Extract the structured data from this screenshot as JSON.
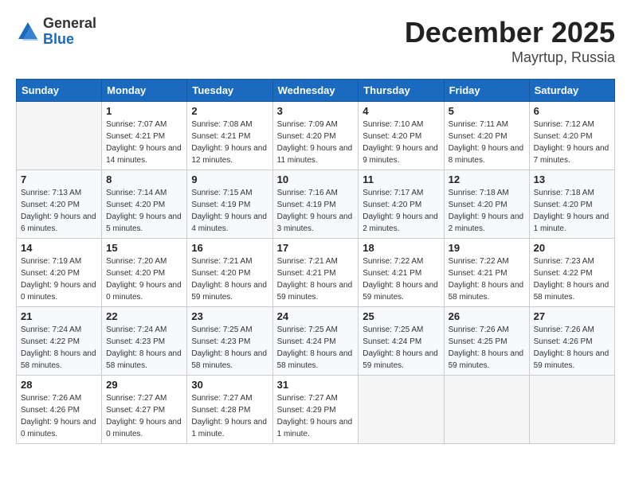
{
  "header": {
    "logo_general": "General",
    "logo_blue": "Blue",
    "month": "December 2025",
    "location": "Mayrtup, Russia"
  },
  "weekdays": [
    "Sunday",
    "Monday",
    "Tuesday",
    "Wednesday",
    "Thursday",
    "Friday",
    "Saturday"
  ],
  "weeks": [
    [
      null,
      {
        "day": "1",
        "sunrise": "7:07 AM",
        "sunset": "4:21 PM",
        "daylight": "9 hours and 14 minutes."
      },
      {
        "day": "2",
        "sunrise": "7:08 AM",
        "sunset": "4:21 PM",
        "daylight": "9 hours and 12 minutes."
      },
      {
        "day": "3",
        "sunrise": "7:09 AM",
        "sunset": "4:20 PM",
        "daylight": "9 hours and 11 minutes."
      },
      {
        "day": "4",
        "sunrise": "7:10 AM",
        "sunset": "4:20 PM",
        "daylight": "9 hours and 9 minutes."
      },
      {
        "day": "5",
        "sunrise": "7:11 AM",
        "sunset": "4:20 PM",
        "daylight": "9 hours and 8 minutes."
      },
      {
        "day": "6",
        "sunrise": "7:12 AM",
        "sunset": "4:20 PM",
        "daylight": "9 hours and 7 minutes."
      }
    ],
    [
      {
        "day": "7",
        "sunrise": "7:13 AM",
        "sunset": "4:20 PM",
        "daylight": "9 hours and 6 minutes."
      },
      {
        "day": "8",
        "sunrise": "7:14 AM",
        "sunset": "4:20 PM",
        "daylight": "9 hours and 5 minutes."
      },
      {
        "day": "9",
        "sunrise": "7:15 AM",
        "sunset": "4:19 PM",
        "daylight": "9 hours and 4 minutes."
      },
      {
        "day": "10",
        "sunrise": "7:16 AM",
        "sunset": "4:19 PM",
        "daylight": "9 hours and 3 minutes."
      },
      {
        "day": "11",
        "sunrise": "7:17 AM",
        "sunset": "4:20 PM",
        "daylight": "9 hours and 2 minutes."
      },
      {
        "day": "12",
        "sunrise": "7:18 AM",
        "sunset": "4:20 PM",
        "daylight": "9 hours and 2 minutes."
      },
      {
        "day": "13",
        "sunrise": "7:18 AM",
        "sunset": "4:20 PM",
        "daylight": "9 hours and 1 minute."
      }
    ],
    [
      {
        "day": "14",
        "sunrise": "7:19 AM",
        "sunset": "4:20 PM",
        "daylight": "9 hours and 0 minutes."
      },
      {
        "day": "15",
        "sunrise": "7:20 AM",
        "sunset": "4:20 PM",
        "daylight": "9 hours and 0 minutes."
      },
      {
        "day": "16",
        "sunrise": "7:21 AM",
        "sunset": "4:20 PM",
        "daylight": "8 hours and 59 minutes."
      },
      {
        "day": "17",
        "sunrise": "7:21 AM",
        "sunset": "4:21 PM",
        "daylight": "8 hours and 59 minutes."
      },
      {
        "day": "18",
        "sunrise": "7:22 AM",
        "sunset": "4:21 PM",
        "daylight": "8 hours and 59 minutes."
      },
      {
        "day": "19",
        "sunrise": "7:22 AM",
        "sunset": "4:21 PM",
        "daylight": "8 hours and 58 minutes."
      },
      {
        "day": "20",
        "sunrise": "7:23 AM",
        "sunset": "4:22 PM",
        "daylight": "8 hours and 58 minutes."
      }
    ],
    [
      {
        "day": "21",
        "sunrise": "7:24 AM",
        "sunset": "4:22 PM",
        "daylight": "8 hours and 58 minutes."
      },
      {
        "day": "22",
        "sunrise": "7:24 AM",
        "sunset": "4:23 PM",
        "daylight": "8 hours and 58 minutes."
      },
      {
        "day": "23",
        "sunrise": "7:25 AM",
        "sunset": "4:23 PM",
        "daylight": "8 hours and 58 minutes."
      },
      {
        "day": "24",
        "sunrise": "7:25 AM",
        "sunset": "4:24 PM",
        "daylight": "8 hours and 58 minutes."
      },
      {
        "day": "25",
        "sunrise": "7:25 AM",
        "sunset": "4:24 PM",
        "daylight": "8 hours and 59 minutes."
      },
      {
        "day": "26",
        "sunrise": "7:26 AM",
        "sunset": "4:25 PM",
        "daylight": "8 hours and 59 minutes."
      },
      {
        "day": "27",
        "sunrise": "7:26 AM",
        "sunset": "4:26 PM",
        "daylight": "8 hours and 59 minutes."
      }
    ],
    [
      {
        "day": "28",
        "sunrise": "7:26 AM",
        "sunset": "4:26 PM",
        "daylight": "9 hours and 0 minutes."
      },
      {
        "day": "29",
        "sunrise": "7:27 AM",
        "sunset": "4:27 PM",
        "daylight": "9 hours and 0 minutes."
      },
      {
        "day": "30",
        "sunrise": "7:27 AM",
        "sunset": "4:28 PM",
        "daylight": "9 hours and 1 minute."
      },
      {
        "day": "31",
        "sunrise": "7:27 AM",
        "sunset": "4:29 PM",
        "daylight": "9 hours and 1 minute."
      },
      null,
      null,
      null
    ]
  ],
  "labels": {
    "sunrise_prefix": "Sunrise: ",
    "sunset_prefix": "Sunset: ",
    "daylight_prefix": "Daylight: "
  }
}
